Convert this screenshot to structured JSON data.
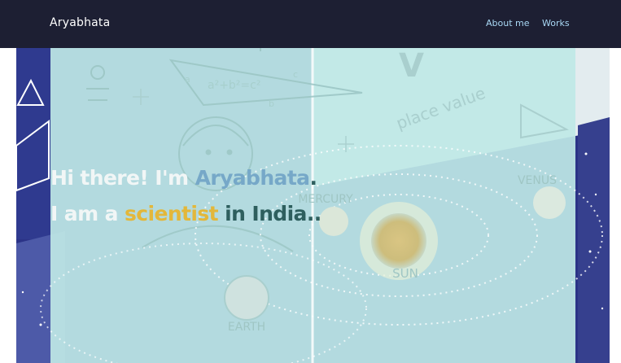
{
  "header": {
    "brand": "Aryabhata",
    "nav": [
      {
        "label": "About me"
      },
      {
        "label": "Works"
      }
    ]
  },
  "hero": {
    "line1": {
      "prefix": "Hi there! I'm ",
      "name": "Aryabhata",
      "suffix": "."
    },
    "line2": {
      "prefix": "I am a ",
      "role": "scientist",
      "middle": " in India",
      "suffix": ".."
    }
  },
  "illustration": {
    "formula": "a²+b²=c²",
    "labels": {
      "a": "a",
      "b": "b",
      "c": "c",
      "place_value": "place value",
      "v": "V",
      "venus": "VENUS",
      "mercury": "MERCURY",
      "sun": "SUN",
      "earth": "EARTH"
    }
  },
  "colors": {
    "navbar": "#1d1f33",
    "nav_link": "#a9d8f5",
    "overlay": "#bfe8e6",
    "name": "#76a8c8",
    "role": "#e3b73a",
    "place": "#2e5f5e"
  }
}
